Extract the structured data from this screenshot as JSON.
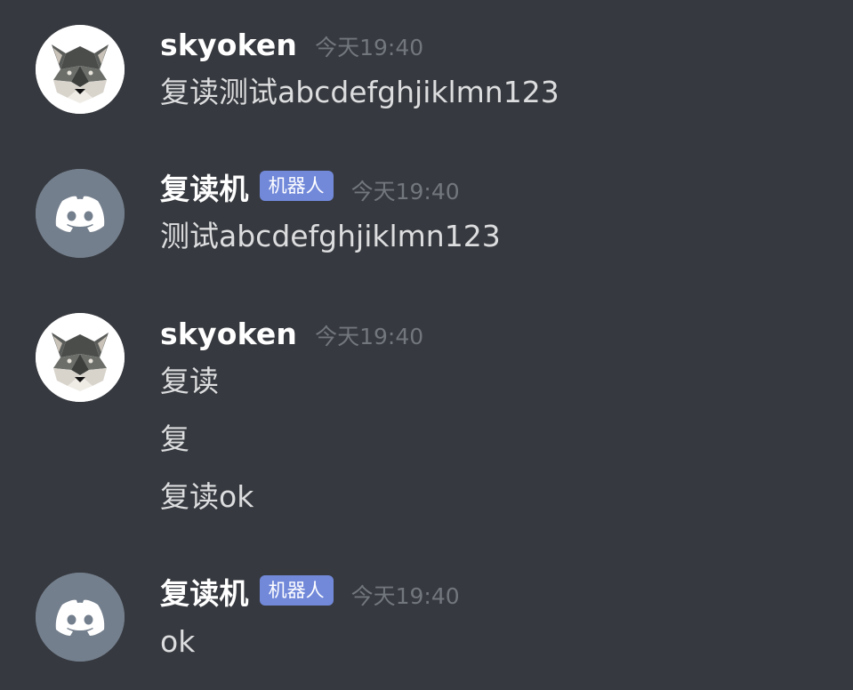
{
  "messages": [
    {
      "author": "skyoken",
      "timestamp": "今天19:40",
      "lines": [
        "复读测试abcdefghjiklmn123"
      ]
    },
    {
      "author": "复读机",
      "bot_tag": "机器人",
      "timestamp": "今天19:40",
      "lines": [
        "测试abcdefghjiklmn123"
      ]
    },
    {
      "author": "skyoken",
      "timestamp": "今天19:40",
      "lines": [
        "复读",
        "复",
        "复读ok"
      ]
    },
    {
      "author": "复读机",
      "bot_tag": "机器人",
      "timestamp": "今天19:40",
      "lines": [
        "ok"
      ]
    }
  ],
  "colors": {
    "background": "#36393f",
    "username": "#ffffff",
    "message_text": "#dcddde",
    "timestamp": "#72767d",
    "bot_tag": "#7289da",
    "bot_avatar": "#747f8d"
  },
  "icons": {
    "user_avatar": "husky-dog-avatar",
    "bot_avatar": "discord-logo-icon"
  }
}
